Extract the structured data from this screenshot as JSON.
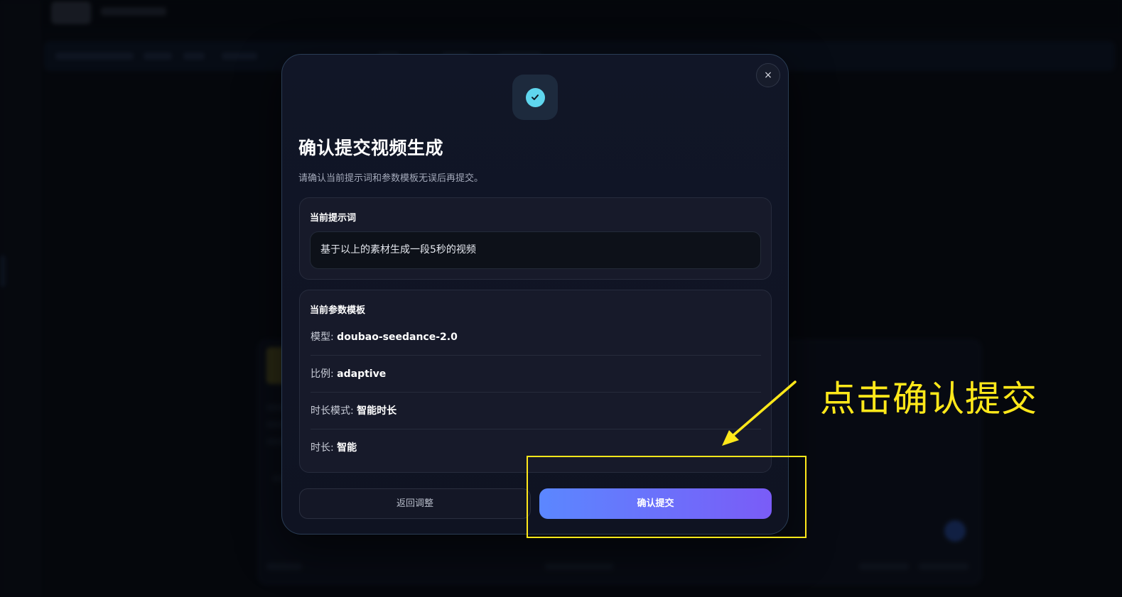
{
  "modal": {
    "close_label": "×",
    "title": "确认提交视频生成",
    "subtitle": "请确认当前提示词和参数模板无误后再提交。",
    "prompt_section": {
      "heading": "当前提示词",
      "value": "基于以上的素材生成一段5秒的视频"
    },
    "params_section": {
      "heading": "当前参数模板",
      "rows": [
        {
          "key": "模型:",
          "value": "doubao-seedance-2.0"
        },
        {
          "key": "比例:",
          "value": "adaptive"
        },
        {
          "key": "时长模式:",
          "value": "智能时长"
        },
        {
          "key": "时长:",
          "value": "智能"
        }
      ]
    },
    "back_label": "返回调整",
    "confirm_label": "确认提交",
    "icon": "check-circle-icon"
  },
  "annotation": {
    "text": "点击确认提交",
    "color": "#ffe81a"
  },
  "colors": {
    "accent_start": "#5b87ff",
    "accent_end": "#7a5cf7",
    "check_badge": "#5fd6ee"
  }
}
